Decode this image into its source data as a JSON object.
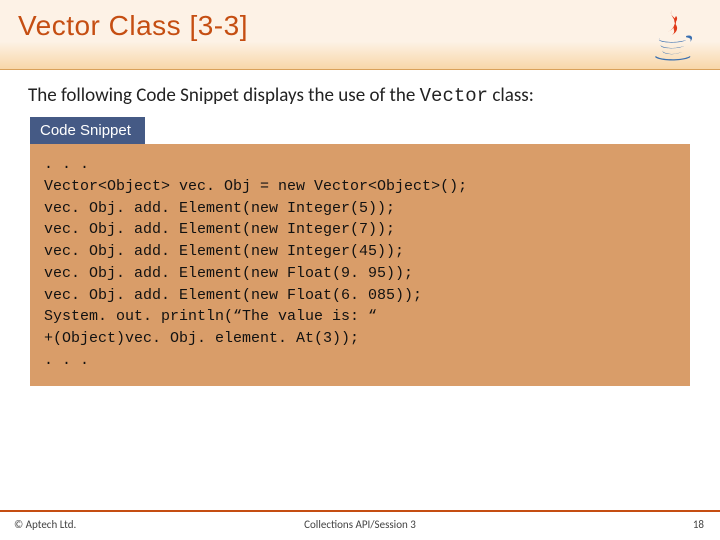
{
  "header": {
    "title": "Vector Class [3-3]"
  },
  "intro": {
    "prefix": "The following Code Snippet displays the use of the ",
    "class_name": "Vector",
    "suffix": " class:"
  },
  "snippet": {
    "tab_label": "Code Snippet",
    "code": ". . .\nVector<Object> vec. Obj = new Vector<Object>();\nvec. Obj. add. Element(new Integer(5));\nvec. Obj. add. Element(new Integer(7));\nvec. Obj. add. Element(new Integer(45));\nvec. Obj. add. Element(new Float(9. 95));\nvec. Obj. add. Element(new Float(6. 085));\nSystem. out. println(“The value is: “\n+(Object)vec. Obj. element. At(3));\n. . ."
  },
  "footer": {
    "copyright": "© Aptech Ltd.",
    "session": "Collections API/Session 3",
    "page": "18"
  },
  "icons": {
    "java_logo": "java-logo"
  }
}
